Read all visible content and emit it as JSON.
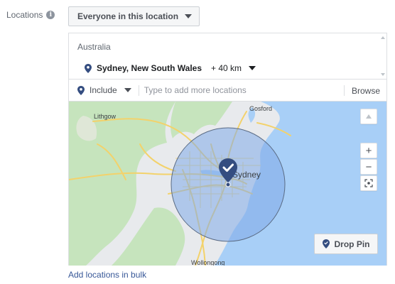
{
  "locations_label": "Locations",
  "info_icon": "info-icon",
  "audience_selector": {
    "label": "Everyone in this location"
  },
  "selected": {
    "country": "Australia",
    "location": {
      "name": "Sydney, New South Wales",
      "radius": "+ 40 km"
    }
  },
  "include_selector": {
    "label": "Include"
  },
  "search": {
    "placeholder": "Type to add more locations",
    "value": ""
  },
  "browse_label": "Browse",
  "map": {
    "labels": {
      "lithgow": "Lithgow",
      "gosford": "Gosford",
      "wollongong": "Wollongong"
    },
    "center_label": "Sydney",
    "controls": {
      "zoom_in": "+",
      "zoom_out": "−"
    },
    "drop_pin_label": "Drop Pin",
    "colors": {
      "water": "#a8cff7",
      "land": "#e8eaed",
      "forest": "#c6e4bd",
      "roads": "#f3d26b",
      "radius_fill": "#7fa9e8",
      "pin": "#344d80"
    }
  },
  "bulk_link": "Add locations in bulk"
}
